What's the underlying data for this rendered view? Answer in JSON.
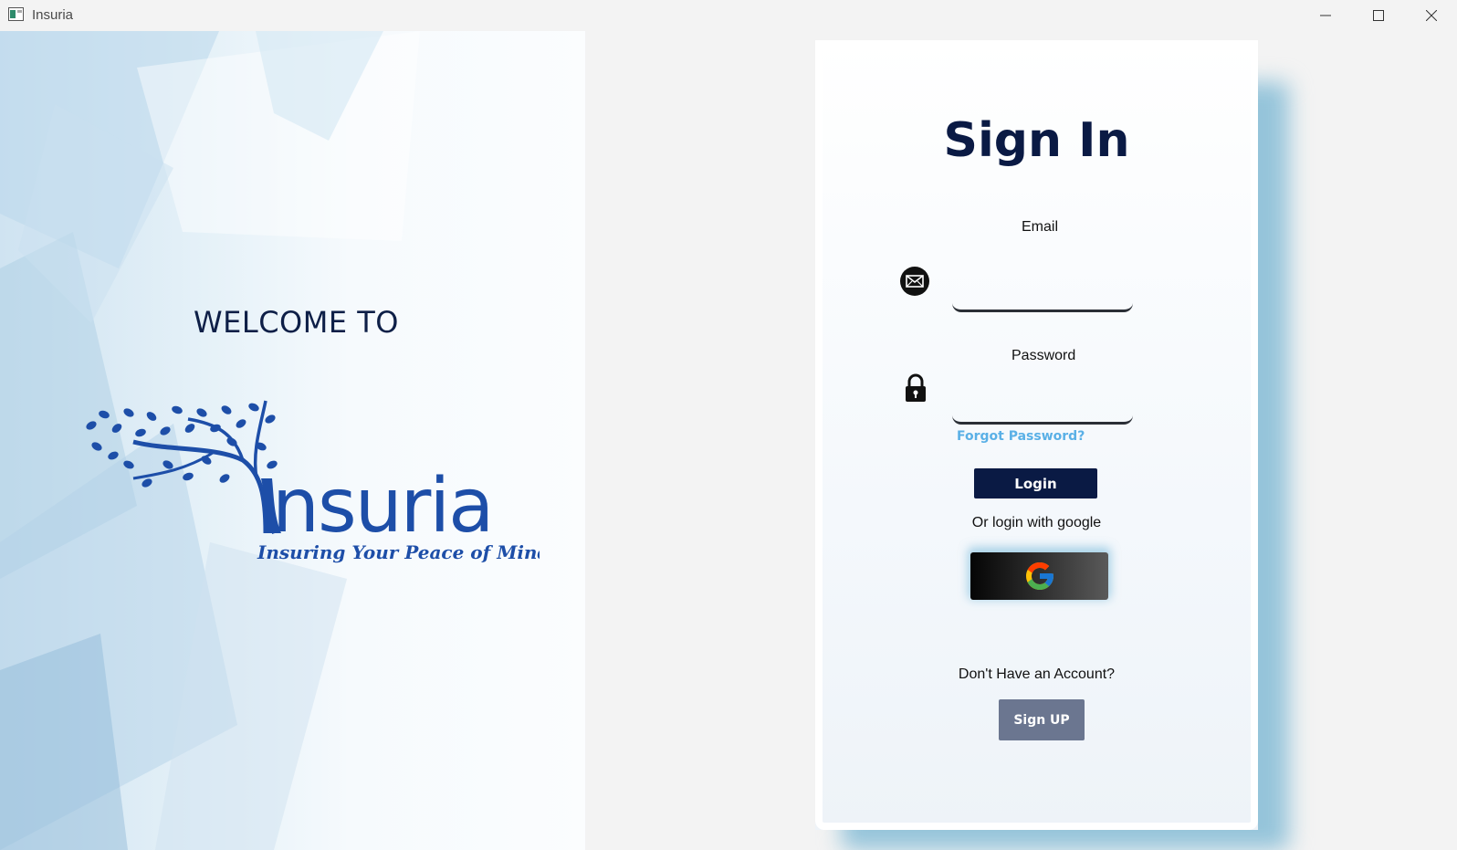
{
  "window": {
    "title": "Insuria",
    "icons": [
      "app-icon",
      "minimize-icon",
      "maximize-icon",
      "close-icon"
    ]
  },
  "welcome": {
    "heading": "WELCOME TO",
    "logo_text": "Insuria",
    "tagline": "Insuring Your Peace of Mind",
    "brand_color": "#1d4ea8"
  },
  "signin": {
    "title": "Sign In",
    "email_label": "Email",
    "email_value": "",
    "password_label": "Password",
    "password_value": "",
    "forgot_password": "Forgot Password?",
    "login_label": "Login",
    "or_google": "Or login with google",
    "no_account": "Don't Have an Account?",
    "signup_label": "Sign UP",
    "icons": [
      "mail-icon",
      "lock-icon",
      "google-icon"
    ]
  },
  "colors": {
    "primary_navy": "#0a1a44",
    "link_blue": "#5ab0e6",
    "signup_gray": "#6b7690",
    "card_shadow": "#95c4da"
  }
}
